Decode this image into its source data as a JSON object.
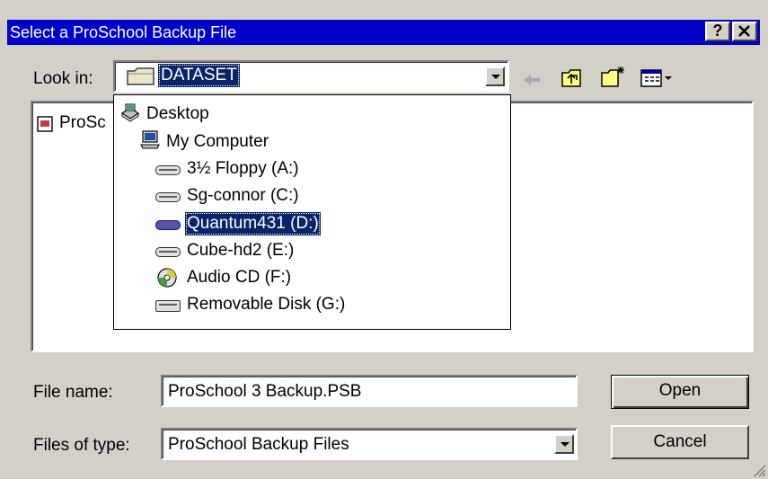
{
  "window": {
    "title": "Select a ProSchool Backup File",
    "help_button": "?",
    "close_button": "✕"
  },
  "toolbar": {
    "look_in_label": "Look in:",
    "look_in_value": "DATASET",
    "back_icon": "back-arrow-icon",
    "up_icon": "up-folder-icon",
    "new_folder_icon": "new-folder-icon",
    "view_menu_icon": "view-menu-icon"
  },
  "file_list": {
    "items": [
      {
        "label": "ProSc",
        "icon": "document-icon"
      }
    ]
  },
  "look_in_dropdown": {
    "items": [
      {
        "label": "Desktop",
        "icon": "desktop-icon"
      },
      {
        "label": "My Computer",
        "icon": "computer-icon"
      },
      {
        "label": "3½ Floppy (A:)",
        "icon": "floppy-drive-icon"
      },
      {
        "label": "Sg-connor (C:)",
        "icon": "hard-drive-icon"
      },
      {
        "label": "Quantum431 (D:)",
        "icon": "hard-drive-icon",
        "selected": true
      },
      {
        "label": "Cube-hd2 (E:)",
        "icon": "hard-drive-icon"
      },
      {
        "label": "Audio CD (F:)",
        "icon": "cd-drive-icon"
      },
      {
        "label": "Removable Disk (G:)",
        "icon": "removable-drive-icon"
      }
    ]
  },
  "file_name": {
    "label": "File name:",
    "value": "ProSchool 3 Backup.PSB"
  },
  "file_type": {
    "label": "Files of type:",
    "value": "ProSchool Backup Files"
  },
  "buttons": {
    "open": "Open",
    "cancel": "Cancel"
  },
  "colors": {
    "titlebar": "#0000c8",
    "dialog": "#d4d0c8",
    "selection": "#0a246a"
  }
}
